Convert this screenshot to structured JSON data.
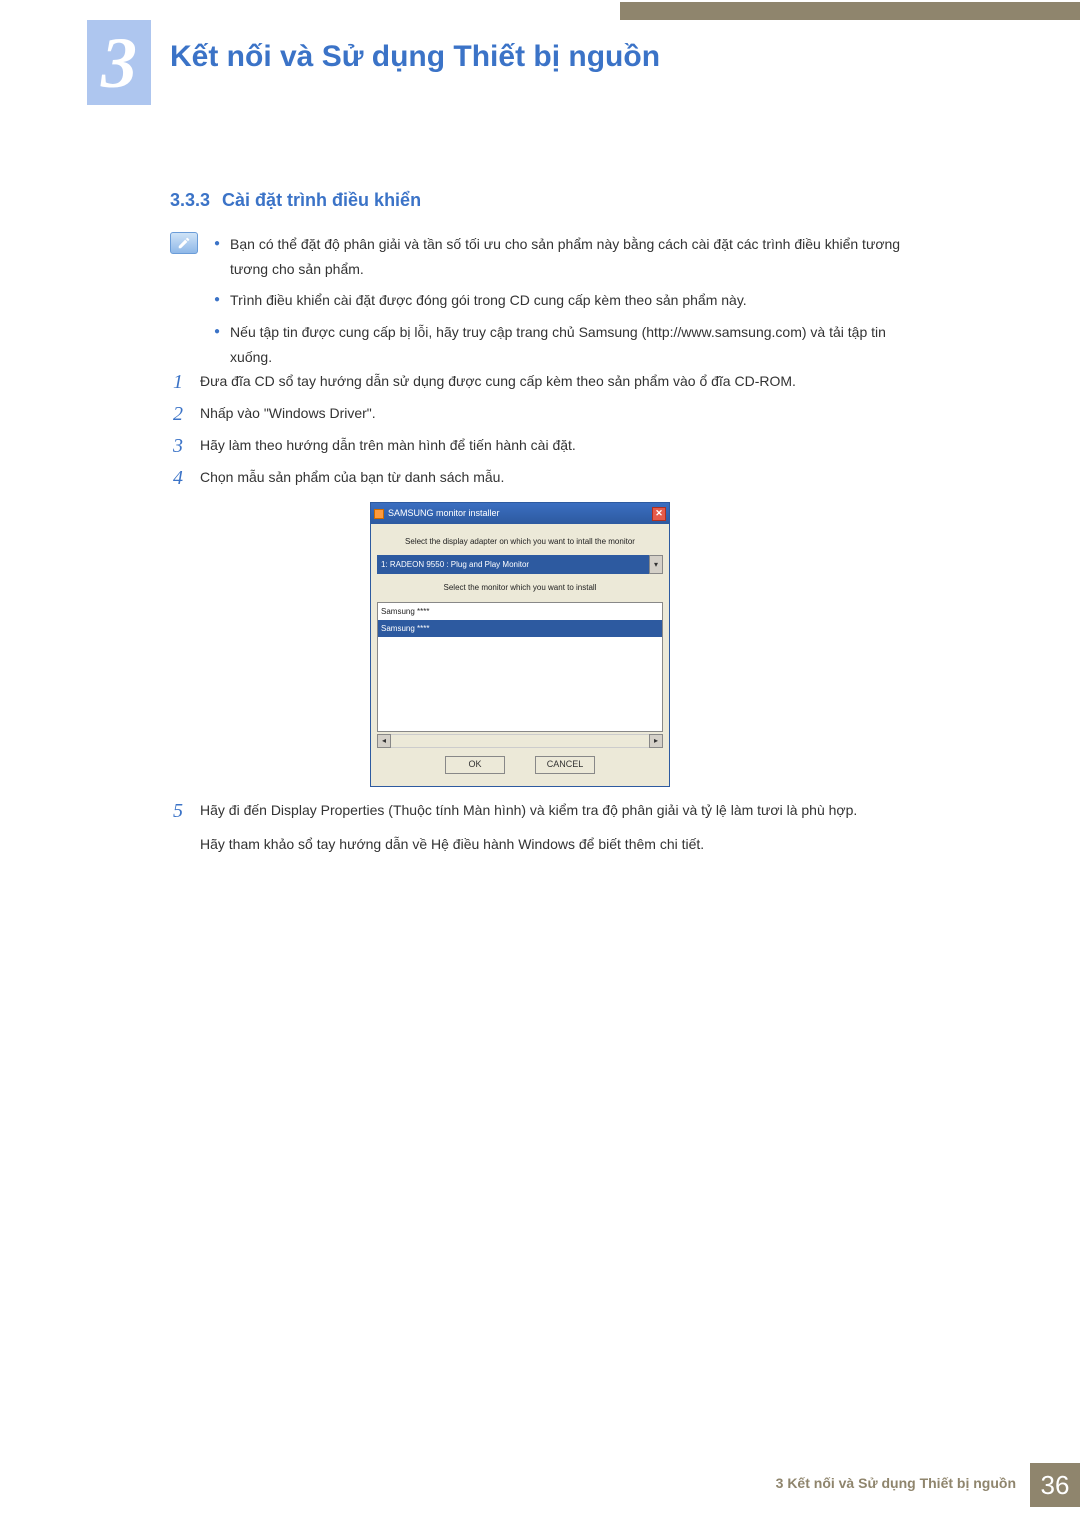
{
  "chapter": {
    "number": "3",
    "title": "Kết nối và Sử dụng Thiết bị nguồn"
  },
  "section": {
    "number": "3.3.3",
    "title": "Cài đặt trình điều khiển"
  },
  "notes": [
    "Bạn có thể đặt độ phân giải và tần số tối ưu cho sản phẩm này bằng cách cài đặt các trình điều khiển tương tương cho sản phẩm.",
    "Trình điều khiển cài đặt được đóng gói trong CD cung cấp kèm theo sản phẩm này.",
    "Nếu tập tin được cung cấp bị lỗi, hãy truy cập trang chủ Samsung (http://www.samsung.com) và tải tập tin xuống."
  ],
  "steps": {
    "s1": {
      "n": "1",
      "t": "Đưa đĩa CD sổ tay hướng dẫn sử dụng được cung cấp kèm theo sản phẩm vào ổ đĩa CD-ROM."
    },
    "s2": {
      "n": "2",
      "t": "Nhấp vào \"Windows Driver\"."
    },
    "s3": {
      "n": "3",
      "t": "Hãy làm theo hướng dẫn trên màn hình để tiến hành cài đặt."
    },
    "s4": {
      "n": "4",
      "t": "Chọn mẫu sản phẩm của bạn từ danh sách mẫu."
    },
    "s5": {
      "n": "5",
      "t": "Hãy đi đến Display Properties (Thuộc tính Màn hình) và kiểm tra độ phân giải và tỷ lệ làm tươi là phù hợp."
    },
    "s5b": "Hãy tham khảo sổ tay hướng dẫn về Hệ điều hành Windows để biết thêm chi tiết."
  },
  "dialog": {
    "title": "SAMSUNG monitor installer",
    "line1": "Select the display adapter on which you want to intall the monitor",
    "select_text": "1: RADEON 9550 : Plug and Play Monitor",
    "line2": "Select the monitor which you want to install",
    "list_item1": "Samsung ****",
    "list_item2": "Samsung ****",
    "ok": "OK",
    "cancel": "CANCEL"
  },
  "footer": {
    "text": "3 Kết nối và Sử dụng Thiết bị nguồn",
    "page": "36"
  }
}
